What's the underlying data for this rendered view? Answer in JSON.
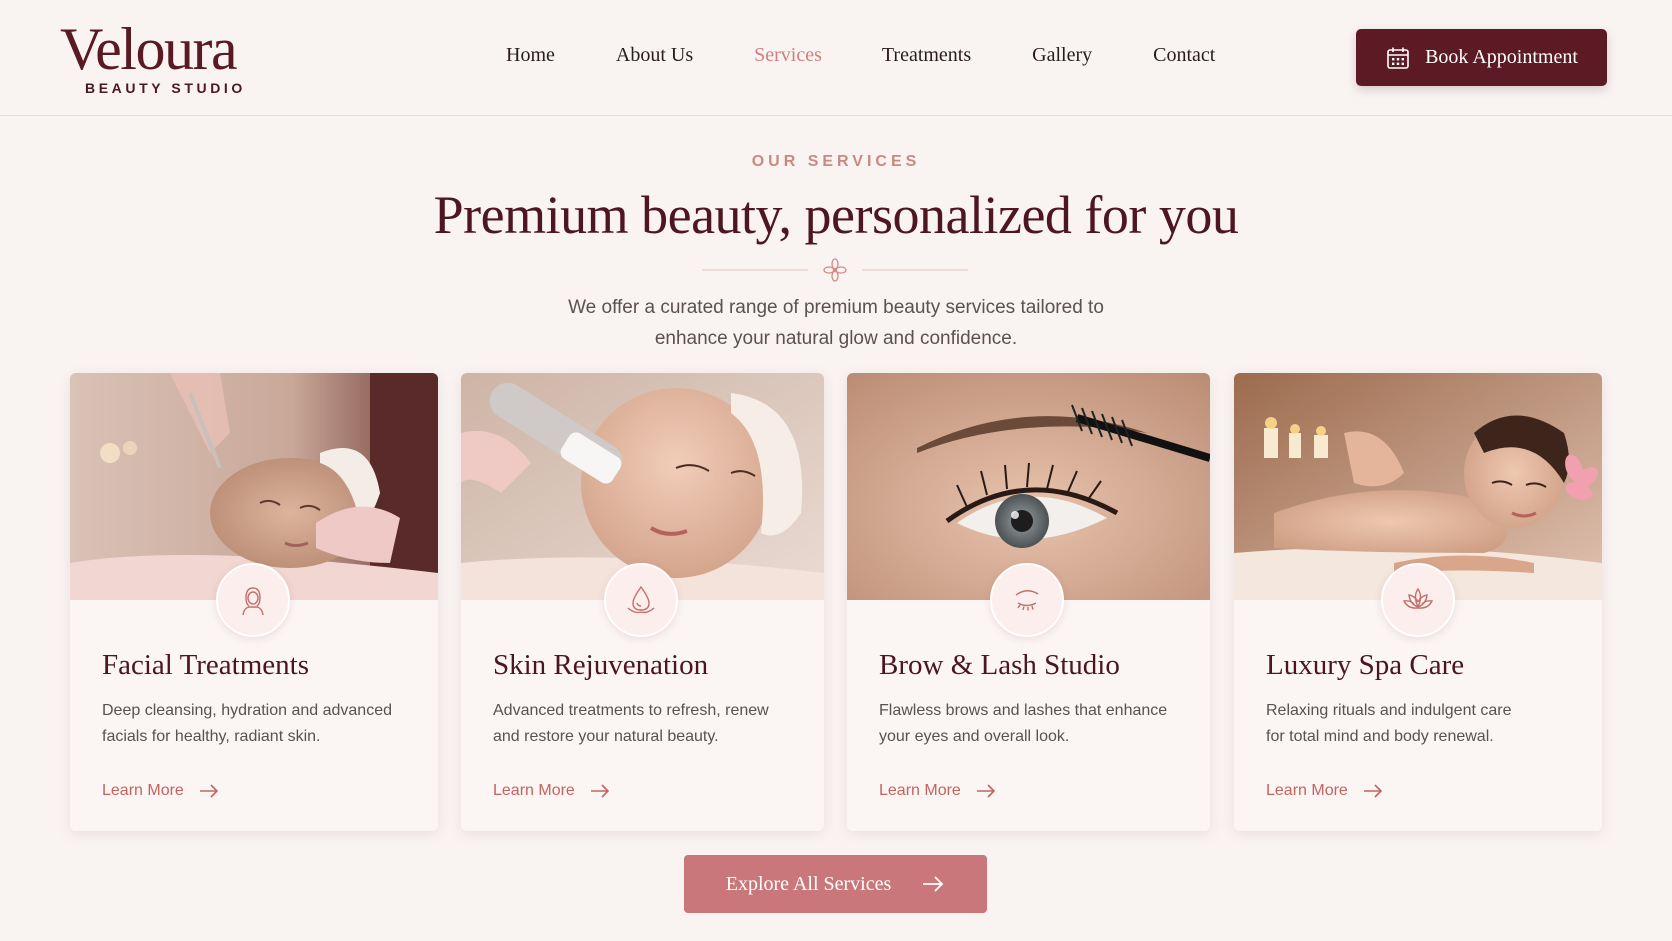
{
  "brand": {
    "name": "Veloura",
    "tagline": "BEAUTY STUDIO",
    "primary_color": "#5b1a24",
    "accent_color": "#c9777a"
  },
  "nav": {
    "items": [
      {
        "label": "Home",
        "active": false
      },
      {
        "label": "About Us",
        "active": false
      },
      {
        "label": "Services",
        "active": true
      },
      {
        "label": "Treatments",
        "active": false
      },
      {
        "label": "Gallery",
        "active": false
      },
      {
        "label": "Contact",
        "active": false
      }
    ],
    "cta_label": "Book Appointment",
    "cta_icon": "calendar-icon"
  },
  "section": {
    "eyebrow": "OUR SERVICES",
    "title": "Premium beauty, personalized for you",
    "divider_icon": "lotus-ornament-icon",
    "lead_line1": "We offer a curated range of premium beauty services tailored to",
    "lead_line2": "enhance your natural glow and confidence."
  },
  "cards": [
    {
      "title": "Facial Treatments",
      "desc_line1": "Deep cleansing, hydration and advanced",
      "desc_line2": "facials for healthy, radiant skin.",
      "link": "Learn More",
      "icon": "woman-face-icon",
      "image": "facial-treatment-photo"
    },
    {
      "title": "Skin Rejuvenation",
      "desc_line1": "Advanced treatments to refresh, renew",
      "desc_line2": "and restore your natural beauty.",
      "link": "Learn More",
      "icon": "water-drop-icon",
      "image": "skin-device-photo"
    },
    {
      "title": "Brow & Lash Studio",
      "desc_line1": "Flawless brows and lashes that enhance",
      "desc_line2": "your eyes and overall look.",
      "link": "Learn More",
      "icon": "eye-lash-icon",
      "image": "eyelash-mascara-photo"
    },
    {
      "title": "Luxury Spa Care",
      "desc_line1": "Relaxing rituals and indulgent care",
      "desc_line2": "for total mind and body renewal.",
      "link": "Learn More",
      "icon": "lotus-icon",
      "image": "spa-massage-photo"
    }
  ],
  "explore": {
    "label": "Explore All Services",
    "icon": "arrow-right-icon"
  }
}
